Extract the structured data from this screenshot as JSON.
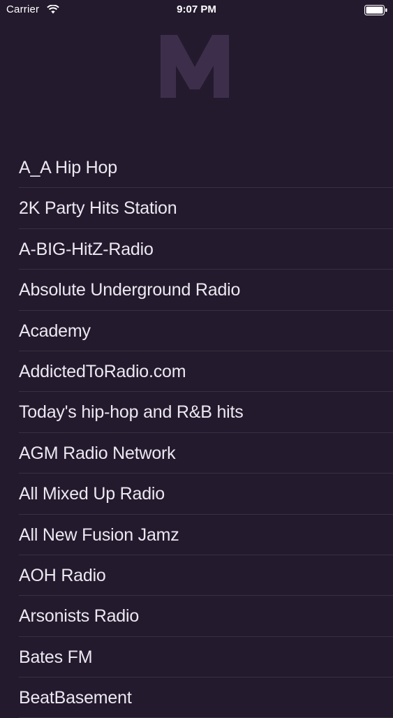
{
  "status_bar": {
    "carrier": "Carrier",
    "time": "9:07 PM",
    "icons": [
      "wifi-icon",
      "battery-icon"
    ]
  },
  "logo": {
    "letter": "M",
    "color": "#3d2f4c"
  },
  "colors": {
    "background": "#241a2e",
    "text": "#ece8f0",
    "separator": "#38303f"
  },
  "stations": [
    "A_A Hip Hop",
    "2K Party Hits Station",
    "A-BIG-HitZ-Radio",
    "Absolute Underground Radio",
    "Academy",
    "AddictedToRadio.com",
    "Today's hip-hop and R&B hits",
    "AGM Radio Network",
    "All Mixed Up Radio",
    "All New Fusion Jamz",
    "AOH Radio",
    "Arsonists Radio",
    "Bates FM",
    "BeatBasement"
  ]
}
